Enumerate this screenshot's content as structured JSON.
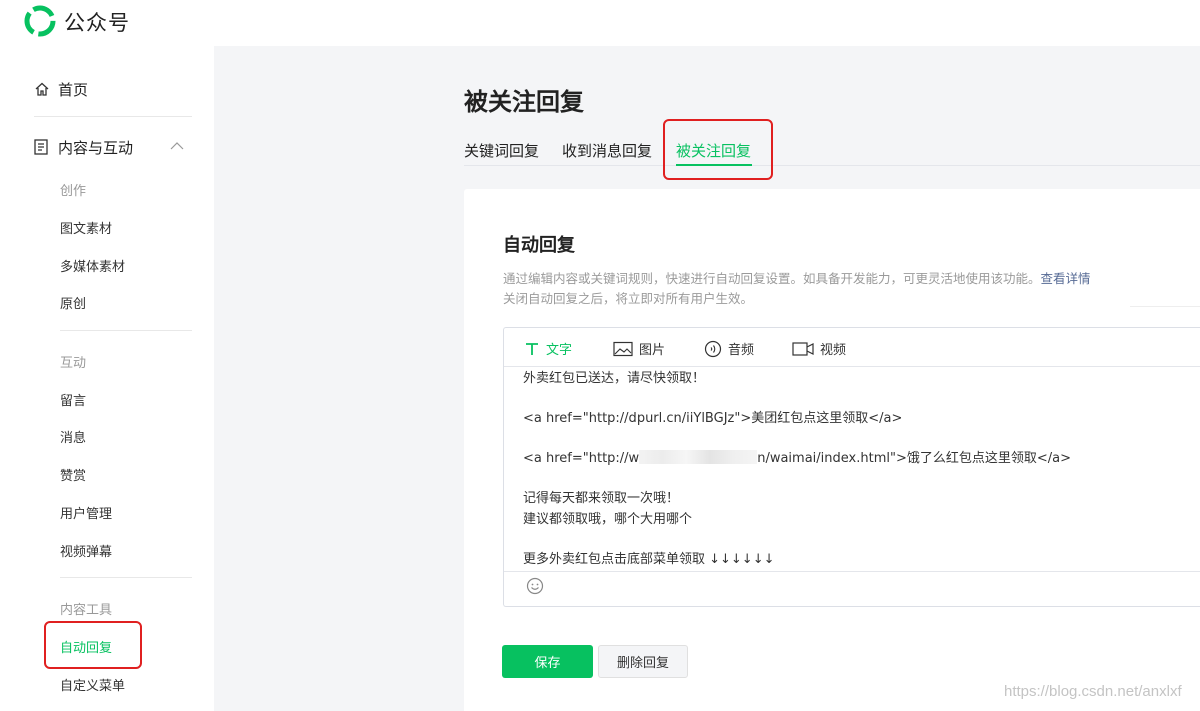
{
  "app": {
    "brand": "公众号"
  },
  "sidebar": {
    "home": "首页",
    "group": "内容与互动",
    "sections": [
      {
        "label": "创作",
        "items": [
          "图文素材",
          "多媒体素材",
          "原创"
        ]
      },
      {
        "label": "互动",
        "items": [
          "留言",
          "消息",
          "赞赏",
          "用户管理",
          "视频弹幕"
        ]
      },
      {
        "label": "内容工具",
        "items": [
          "自动回复",
          "自定义菜单"
        ]
      }
    ],
    "active_item": "自动回复"
  },
  "main": {
    "title": "被关注回复",
    "tabs": [
      {
        "label": "关键词回复",
        "active": false
      },
      {
        "label": "收到消息回复",
        "active": false
      },
      {
        "label": "被关注回复",
        "active": true
      }
    ],
    "card": {
      "title": "自动回复",
      "desc_line1": "通过编辑内容或关键词规则，快速进行自动回复设置。如具备开发能力，可更灵活地使用该功能。",
      "desc_link": "查看详情",
      "desc_line2": "关闭自动回复之后，将立即对所有用户生效。"
    },
    "editor": {
      "tabs": [
        {
          "label": "文字",
          "icon": "text-icon",
          "active": true
        },
        {
          "label": "图片",
          "icon": "image-icon",
          "active": false
        },
        {
          "label": "音频",
          "icon": "audio-icon",
          "active": false
        },
        {
          "label": "视频",
          "icon": "video-icon",
          "active": false
        }
      ],
      "lines": {
        "l1": "外卖红包已送达，请尽快领取！",
        "l2": "<a href=\"http://dpurl.cn/iiYlBGJz\">美团红包点这里领取</a>",
        "l3a": "<a href=\"http://w",
        "l3b": "n/waimai/index.html\">饿了么红包点这里领取</a>",
        "l4": "记得每天都来领取一次哦！",
        "l5": "建议都领取哦，哪个大用哪个",
        "l6": "更多外卖红包点击底部菜单领取 ↓↓↓↓↓↓"
      }
    },
    "buttons": {
      "save": "保存",
      "delete": "删除回复"
    }
  },
  "watermark": "https://blog.csdn.net/anxlxf",
  "colors": {
    "accent": "#07c160",
    "highlight_box": "#e02020",
    "link": "#576b95"
  }
}
